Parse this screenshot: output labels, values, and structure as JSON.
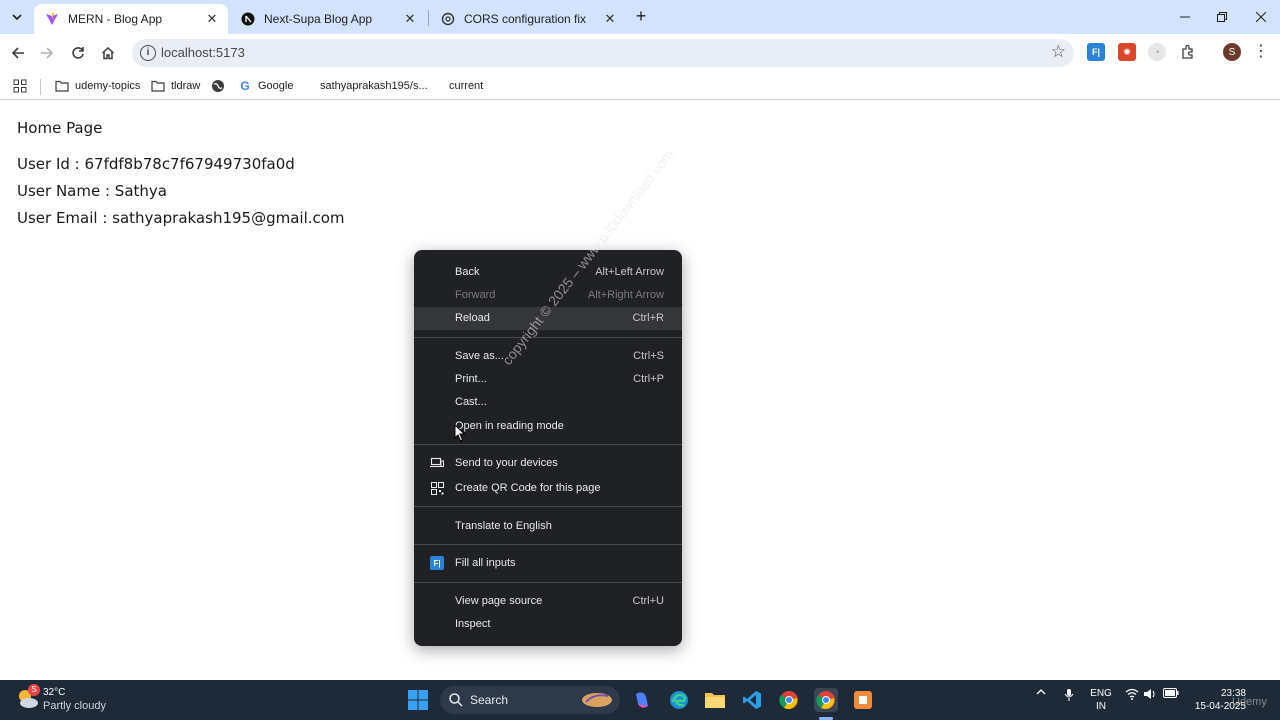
{
  "browser": {
    "tabs": [
      {
        "title": "MERN - Blog App",
        "active": true
      },
      {
        "title": "Next-Supa Blog App",
        "active": false
      },
      {
        "title": "CORS configuration fix",
        "active": false
      }
    ],
    "url": "localhost:5173",
    "bookmarks": [
      {
        "label": "udemy-topics",
        "icon": "folder-icon"
      },
      {
        "label": "tldraw",
        "icon": "folder-icon"
      },
      {
        "label": "",
        "icon": "globe-icon"
      },
      {
        "label": "Google",
        "icon": "google-icon"
      },
      {
        "label": "sathyaprakash195/s...",
        "icon": ""
      },
      {
        "label": "current",
        "icon": ""
      }
    ],
    "profile_initial": "S"
  },
  "page": {
    "heading": "Home Page",
    "user_id": "User Id : 67fdf8b78c7f67949730fa0d",
    "user_name": "User Name : Sathya",
    "user_email": "User Email : sathyaprakash195@gmail.com"
  },
  "context_menu": {
    "items": [
      {
        "label": "Back",
        "shortcut": "Alt+Left Arrow"
      },
      {
        "label": "Forward",
        "shortcut": "Alt+Right Arrow",
        "disabled": true
      },
      {
        "label": "Reload",
        "shortcut": "Ctrl+R",
        "hover": true
      },
      {
        "label": "Save as...",
        "shortcut": "Ctrl+S"
      },
      {
        "label": "Print...",
        "shortcut": "Ctrl+P"
      },
      {
        "label": "Cast...",
        "shortcut": ""
      },
      {
        "label": "Open in reading mode",
        "shortcut": ""
      },
      {
        "label": "Send to your devices",
        "shortcut": "",
        "icon": "devices-icon"
      },
      {
        "label": "Create QR Code for this page",
        "shortcut": "",
        "icon": "qr-code-icon"
      },
      {
        "label": "Translate to English",
        "shortcut": ""
      },
      {
        "label": "Fill all inputs",
        "shortcut": "",
        "icon": "fake-filler-icon"
      },
      {
        "label": "View page source",
        "shortcut": "Ctrl+U"
      },
      {
        "label": "Inspect",
        "shortcut": ""
      }
    ]
  },
  "watermark": "copyright © 2025 – www.p30download.com",
  "taskbar": {
    "weather_temp": "32°C",
    "weather_condition": "Partly cloudy",
    "weather_badge": "S",
    "search_label": "Search",
    "lang_line1": "ENG",
    "lang_line2": "IN",
    "time": "23:38",
    "date": "15-04-2025",
    "udemy": "Udemy"
  }
}
